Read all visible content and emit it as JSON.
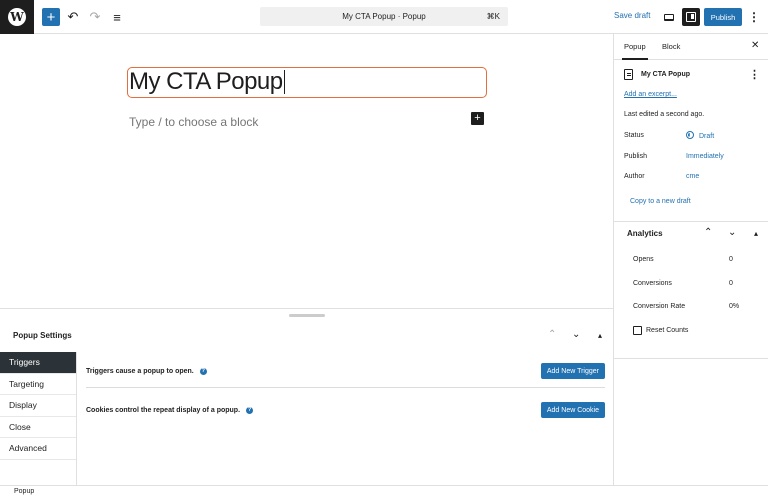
{
  "toolbar": {
    "logo_glyph": "W",
    "add_block_glyph": "+",
    "undo_glyph": "↶",
    "redo_glyph": "↷",
    "list_view_glyph": "≡",
    "document_title": "My CTA Popup · Popup",
    "shortcut": "⌘K",
    "save_draft_label": "Save draft",
    "publish_label": "Publish",
    "options_glyph": "⋮",
    "accent_color": "#2271b1"
  },
  "editor": {
    "post_title": "My CTA Popup",
    "block_placeholder": "Type / to choose a block",
    "inline_add_glyph": "+",
    "title_focus_color": "#e26f3c"
  },
  "popup_settings": {
    "title": "Popup Settings",
    "controls": {
      "up": "⌃",
      "down": "⌄",
      "collapse": "▴"
    },
    "tabs": [
      {
        "label": "Triggers",
        "active": true
      },
      {
        "label": "Targeting",
        "active": false
      },
      {
        "label": "Display",
        "active": false
      },
      {
        "label": "Close",
        "active": false
      },
      {
        "label": "Advanced",
        "active": false
      }
    ],
    "triggers": {
      "description": "Triggers cause a popup to open.",
      "button_label": "Add New Trigger"
    },
    "cookies": {
      "description": "Cookies control the repeat display of a popup.",
      "button_label": "Add New Cookie"
    },
    "help_glyph": "?"
  },
  "sidebar": {
    "tabs": [
      "Popup",
      "Block"
    ],
    "close_glyph": "✕",
    "document": {
      "title": "My CTA Popup",
      "menu_glyph": "⋮",
      "excerpt_link": "Add an excerpt...",
      "last_edited": "Last edited a second ago."
    },
    "meta": {
      "status_label": "Status",
      "status_value": "Draft",
      "publish_label": "Publish",
      "publish_value": "Immediately",
      "author_label": "Author",
      "author_value": "cme"
    },
    "copy_link": "Copy to a new draft",
    "analytics": {
      "title": "Analytics",
      "controls": {
        "up": "⌃",
        "down": "⌄",
        "collapse": "▴"
      },
      "rows": [
        {
          "label": "Opens",
          "value": "0"
        },
        {
          "label": "Conversions",
          "value": "0"
        },
        {
          "label": "Conversion Rate",
          "value": "0%"
        }
      ],
      "reset_label": "Reset Counts",
      "reset_checked": false
    }
  },
  "footer": {
    "breadcrumb": "Popup"
  }
}
